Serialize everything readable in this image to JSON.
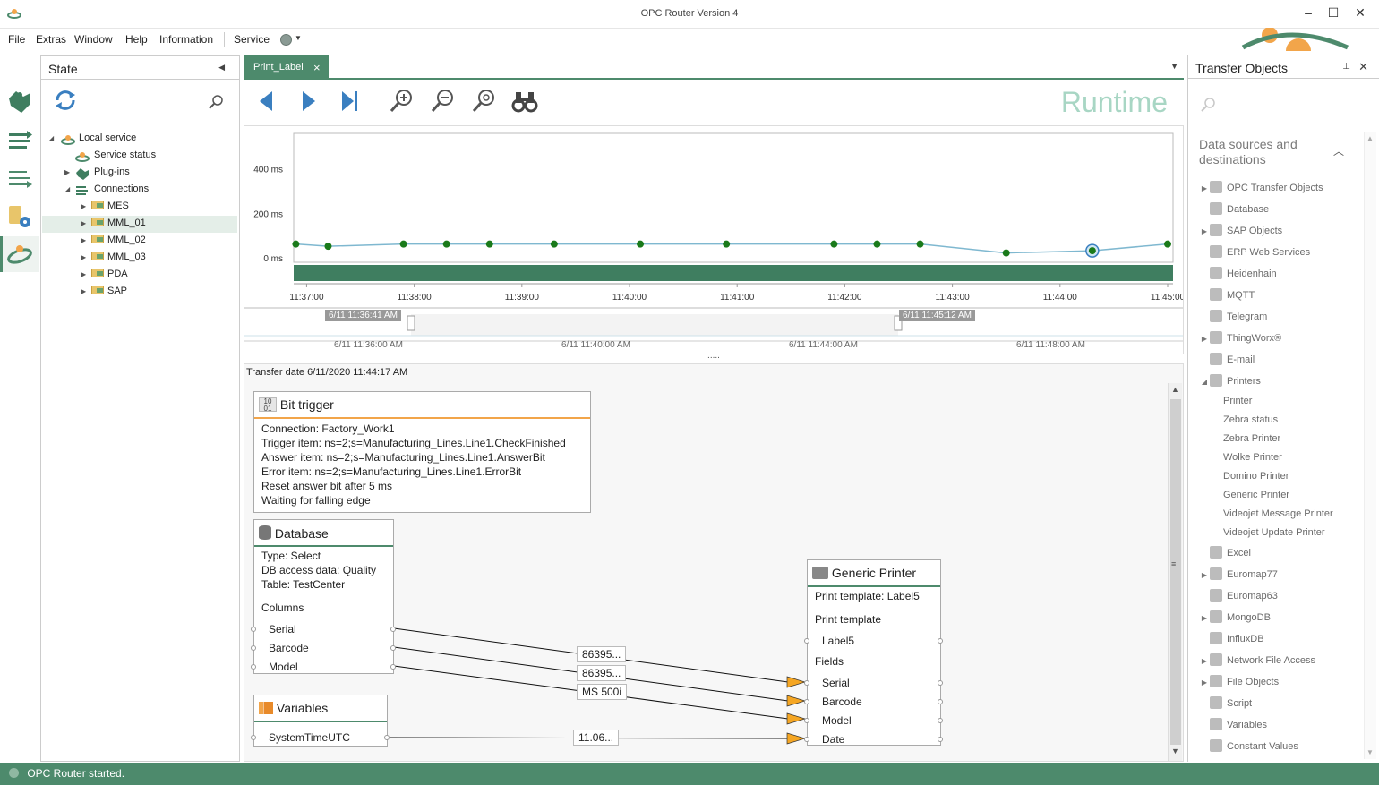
{
  "window": {
    "title": "OPC Router Version 4"
  },
  "menu": {
    "file": "File",
    "extras": "Extras",
    "window": "Window",
    "help": "Help",
    "information": "Information",
    "service": "Service"
  },
  "state_panel": {
    "title": "State",
    "tree": [
      {
        "label": "Local service"
      },
      {
        "label": "Service status"
      },
      {
        "label": "Plug-ins"
      },
      {
        "label": "Connections"
      },
      {
        "label": "MES"
      },
      {
        "label": "MML_01"
      },
      {
        "label": "MML_02"
      },
      {
        "label": "MML_03"
      },
      {
        "label": "PDA"
      },
      {
        "label": "SAP"
      }
    ]
  },
  "tab": {
    "label": "Print_Label",
    "close": "×"
  },
  "toolbar": {
    "mode_label": "Runtime"
  },
  "chart_data": {
    "type": "line",
    "title": "",
    "xlabel": "",
    "ylabel": "",
    "y_tick_labels": [
      "400 ms",
      "200 ms",
      "0 ms"
    ],
    "y_ticks": [
      400,
      200,
      0
    ],
    "ylim": [
      -20,
      560
    ],
    "x_tick_labels": [
      "11:37:00",
      "11:38:00",
      "11:39:00",
      "11:40:00",
      "11:41:00",
      "11:42:00",
      "11:43:00",
      "11:44:00",
      "11:45:00"
    ],
    "x_ticks_min": [
      0,
      1,
      2,
      3,
      4,
      5,
      6,
      7,
      8
    ],
    "xlim_min": [
      -0.12,
      8.05
    ],
    "series": [
      {
        "x_min": [
          -0.1,
          0.2,
          0.9,
          1.3,
          1.7,
          2.3,
          3.1,
          3.9,
          4.9,
          5.3,
          5.7,
          6.5,
          7.3,
          8.0
        ],
        "values": [
          62,
          52,
          62,
          62,
          62,
          62,
          62,
          62,
          62,
          62,
          62,
          22,
          32,
          62
        ],
        "color": "#7fb8d0",
        "marker_color": "#1a7a1a"
      }
    ],
    "selected_index": 12,
    "grid": false,
    "legend": "none"
  },
  "overview": {
    "start_label": "6/11 11:36:41 AM",
    "end_label": "6/11 11:45:12 AM",
    "ticks": [
      "6/11 11:36:00 AM",
      "6/11 11:40:00 AM",
      "6/11 11:44:00 AM",
      "6/11 11:48:00 AM"
    ]
  },
  "splitter": {
    "grip": "....."
  },
  "canvas": {
    "transfer_date": "Transfer date 6/11/2020 11:44:17 AM",
    "bit_trigger": {
      "title": "Bit trigger",
      "lines": [
        "Connection: Factory_Work1",
        "Trigger item: ns=2;s=Manufacturing_Lines.Line1.CheckFinished",
        "Answer item: ns=2;s=Manufacturing_Lines.Line1.AnswerBit",
        "Error item: ns=2;s=Manufacturing_Lines.Line1.ErrorBit",
        "Reset answer bit after 5 ms",
        "Waiting for falling edge"
      ]
    },
    "database": {
      "title": "Database",
      "type": "Type: Select",
      "access": "DB access data: Quality",
      "table": "Table: TestCenter",
      "columns_label": "Columns",
      "columns": [
        "Serial",
        "Barcode",
        "Model"
      ]
    },
    "variables": {
      "title": "Variables",
      "fields": [
        "SystemTimeUTC"
      ]
    },
    "printer": {
      "title": "Generic Printer",
      "template": "Print template: Label5",
      "template_group": "Print template",
      "template_field": "Label5",
      "fields_label": "Fields",
      "fields": [
        "Serial",
        "Barcode",
        "Model",
        "Date"
      ]
    },
    "values": [
      "86395...",
      "86395...",
      "MS 500i",
      "11.06..."
    ]
  },
  "transfer_objects": {
    "title": "Transfer Objects",
    "section": "Data sources and destinations",
    "items": [
      {
        "label": "OPC Transfer Objects",
        "expandable": true
      },
      {
        "label": "Database",
        "expandable": false
      },
      {
        "label": "SAP Objects",
        "expandable": true
      },
      {
        "label": "ERP Web Services",
        "expandable": false
      },
      {
        "label": "Heidenhain",
        "expandable": false
      },
      {
        "label": "MQTT",
        "expandable": false
      },
      {
        "label": "Telegram",
        "expandable": false
      },
      {
        "label": "ThingWorx®",
        "expandable": true
      },
      {
        "label": "E-mail",
        "expandable": false
      },
      {
        "label": "Printers",
        "expandable": true
      },
      {
        "label": "Printer",
        "child": true
      },
      {
        "label": "Zebra status",
        "child": true
      },
      {
        "label": "Zebra Printer",
        "child": true
      },
      {
        "label": "Wolke Printer",
        "child": true
      },
      {
        "label": "Domino Printer",
        "child": true
      },
      {
        "label": "Generic Printer",
        "child": true
      },
      {
        "label": "Videojet Message Printer",
        "child": true
      },
      {
        "label": "Videojet Update Printer",
        "child": true
      },
      {
        "label": "Excel",
        "expandable": false
      },
      {
        "label": "Euromap77",
        "expandable": true
      },
      {
        "label": "Euromap63",
        "expandable": false
      },
      {
        "label": "MongoDB",
        "expandable": true
      },
      {
        "label": "InfluxDB",
        "expandable": false
      },
      {
        "label": "Network File Access",
        "expandable": true
      },
      {
        "label": "File Objects",
        "expandable": true
      },
      {
        "label": "Script",
        "expandable": false
      },
      {
        "label": "Variables",
        "expandable": false
      },
      {
        "label": "Constant Values",
        "expandable": false
      }
    ]
  },
  "status": {
    "text": "OPC Router started."
  },
  "colors": {
    "accent": "#4d8a6c",
    "node_header_line": "#f2a54a",
    "arrow": "#f5a623",
    "marker": "#1a7a1a",
    "line": "#7fb8d0"
  }
}
